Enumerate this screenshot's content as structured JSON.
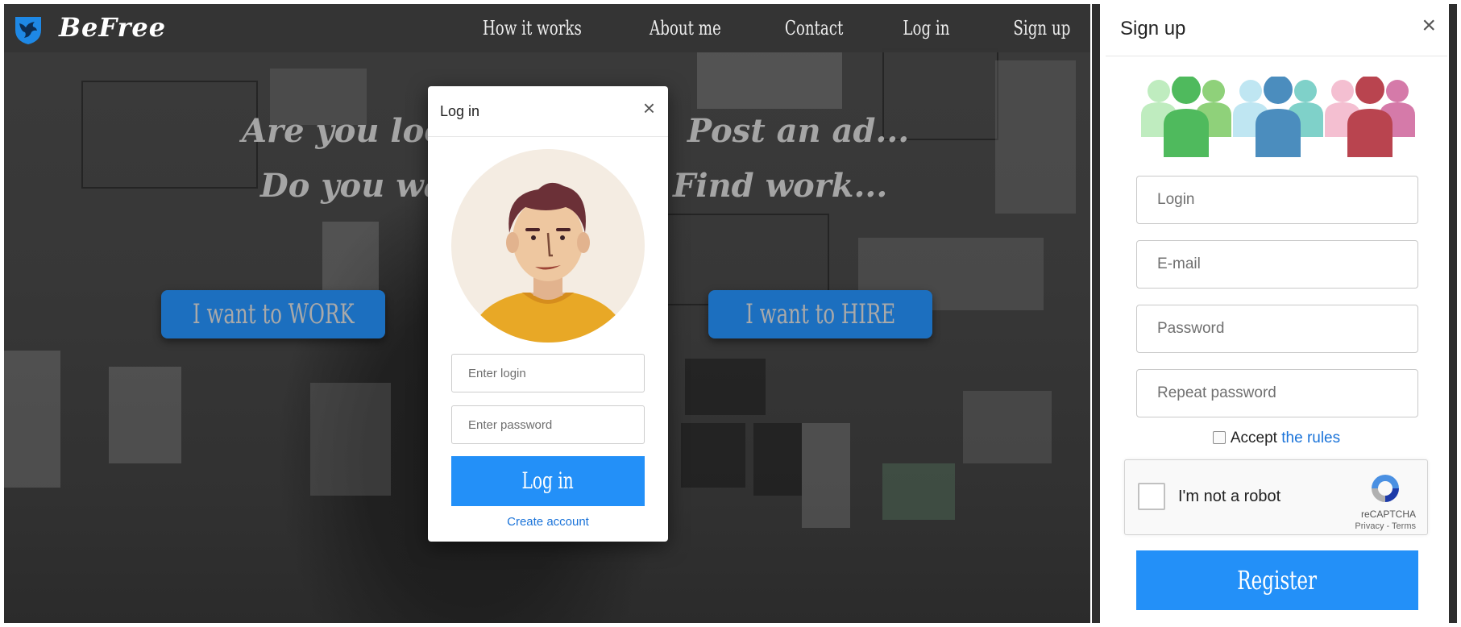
{
  "brand": {
    "name": "BeFree"
  },
  "nav": {
    "items": [
      "How it works",
      "About me",
      "Contact",
      "Log in",
      "Sign up"
    ]
  },
  "hero": {
    "line1_left": "Are you lookin",
    "line1_right": "Post an ad...",
    "line2_left": "Do you want",
    "line2_right": "Find work...",
    "work_button": "I want to WORK",
    "hire_button": "I want to HIRE"
  },
  "login_modal": {
    "title": "Log in",
    "close": "×",
    "login_placeholder": "Enter login",
    "password_placeholder": "Enter password",
    "submit": "Log in",
    "create_account": "Create account"
  },
  "signup": {
    "title": "Sign up",
    "close": "×",
    "login_placeholder": "Login",
    "email_placeholder": "E-mail",
    "password_placeholder": "Password",
    "repeat_password_placeholder": "Repeat password",
    "accept_text": "Accept",
    "rules_link": "the rules",
    "captcha_label": "I'm not a robot",
    "captcha_brand": "reCAPTCHA",
    "captcha_terms": "Privacy - Terms",
    "register": "Register"
  },
  "colors": {
    "primary_button": "#2390f8",
    "hero_button": "#1c6fbf",
    "link": "#1a73d9",
    "topbar": "#343434"
  },
  "icons": [
    "bird-logo-icon",
    "close-icon",
    "user-avatar-icon",
    "people-group-icon",
    "recaptcha-icon"
  ]
}
